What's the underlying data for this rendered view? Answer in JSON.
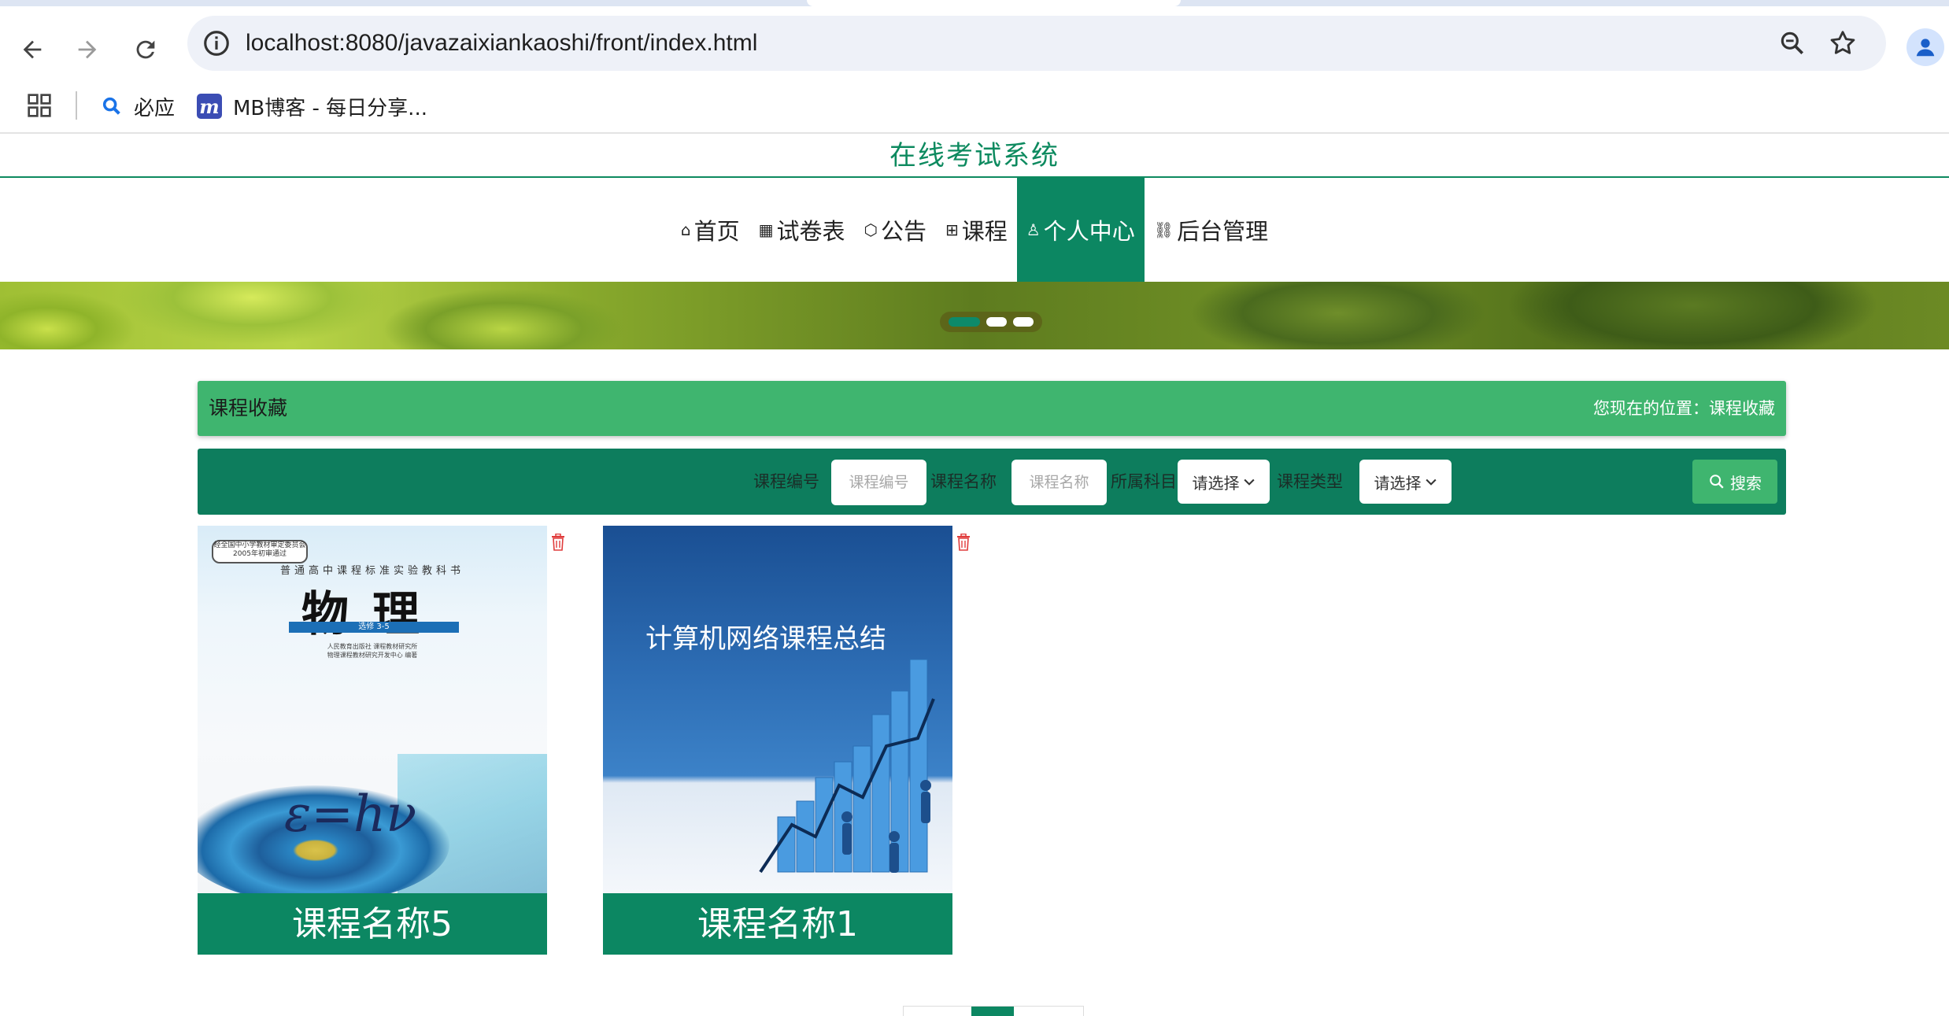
{
  "browser": {
    "url": "localhost:8080/javazaixiankaoshi/front/index.html",
    "bookmarks": [
      {
        "label": "必应",
        "icon": "bing-search-icon"
      },
      {
        "label": "MB博客 - 每日分享...",
        "icon": "mb-blog-icon"
      }
    ]
  },
  "site": {
    "title": "在线考试系统"
  },
  "nav": {
    "items": [
      {
        "label": "首页",
        "icon": "home-icon",
        "active": false
      },
      {
        "label": "试卷表",
        "icon": "grid-icon",
        "active": false
      },
      {
        "label": "公告",
        "icon": "cube-icon",
        "active": false
      },
      {
        "label": "课程",
        "icon": "gift-icon",
        "active": false
      },
      {
        "label": "个人中心",
        "icon": "user-icon",
        "active": true
      },
      {
        "label": "后台管理",
        "icon": "link-icon",
        "active": false
      }
    ]
  },
  "banner": {
    "dots": 3,
    "active_dot": 1
  },
  "section": {
    "title": "课程收藏",
    "breadcrumb": "您现在的位置：课程收藏"
  },
  "search": {
    "course_no_label": "课程编号",
    "course_no_placeholder": "课程编号",
    "course_name_label": "课程名称",
    "course_name_placeholder": "课程名称",
    "subject_label": "所属科目",
    "subject_value": "请选择",
    "type_label": "课程类型",
    "type_value": "请选择",
    "button_label": "搜索"
  },
  "cards": [
    {
      "caption": "课程名称5",
      "cover": {
        "badge": "经全国中小学教材审定委员会 2005年初审通过",
        "series": "普通高中课程标准实验教科书",
        "subject": "物理",
        "volume": "选修 3-5",
        "publisher_line1": "人民教育出版社  课程教材研究所",
        "publisher_line2": "物理课程教材研究开发中心  编著",
        "formula": "ε=hν"
      }
    },
    {
      "caption": "课程名称1",
      "cover": {
        "title": "计算机网络课程总结"
      }
    }
  ],
  "theme": {
    "primary": "#0c8762",
    "accent": "#3fb56f",
    "title_green": "#0d8a5f"
  }
}
